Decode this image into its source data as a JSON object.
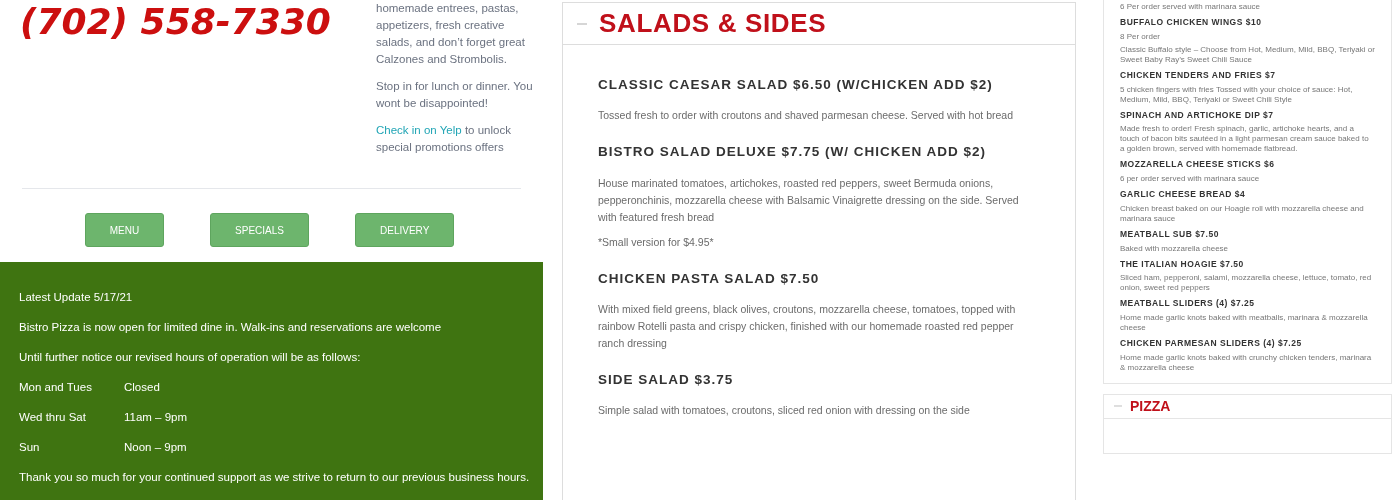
{
  "phone": "(702) 558-7330",
  "intro": {
    "paragraphs": [
      {
        "text": "homemade entrees, pastas, appetizers, fresh creative salads, and don’t forget great Calzones and Strombolis."
      },
      {
        "text": "Stop in for lunch or dinner. You wont be disappointed!"
      },
      {
        "link": "Check in on Yelp",
        "text": " to unlock special promotions offers"
      }
    ]
  },
  "nav_buttons": [
    "MENU",
    "SPECIALS",
    "DELIVERY"
  ],
  "notice": {
    "lines": [
      "Latest Update 5/17/21",
      "Bistro Pizza is now open for limited dine in. Walk-ins and reservations are welcome",
      "Until further notice our revised hours of operation will be as follows:"
    ],
    "hours": [
      {
        "day": "Mon and Tues",
        "time": "Closed"
      },
      {
        "day": "Wed thru Sat",
        "time": "11am – 9pm"
      },
      {
        "day": "Sun",
        "time": "Noon – 9pm"
      }
    ],
    "closing": "Thank you so much for your continued support as we strive to return to our previous business hours."
  },
  "salads_section": {
    "title": "SALADS & SIDES",
    "expanded": true,
    "items": [
      {
        "name": "CLASSIC CAESAR SALAD $6.50 (W/CHICKEN ADD $2)",
        "descriptions": [
          "Tossed fresh to order with croutons and shaved parmesan cheese. Served with hot bread"
        ]
      },
      {
        "name": "BISTRO SALAD DELUXE $7.75 (W/ CHICKEN ADD $2)",
        "descriptions": [
          "House marinated tomatoes, artichokes, roasted red peppers, sweet Bermuda onions, pepperonchinis, mozzarella cheese with Balsamic Vinaigrette dressing on the side. Served with featured fresh bread",
          "*Small version for $4.95*"
        ]
      },
      {
        "name": "CHICKEN PASTA SALAD $7.50",
        "descriptions": [
          "With mixed field greens, black olives, croutons, mozzarella cheese, tomatoes, topped with rainbow Rotelli pasta and crispy chicken, finished with our homemade roasted red pepper ranch dressing"
        ]
      },
      {
        "name": "SIDE SALAD $3.75",
        "descriptions": [
          "Simple salad with tomatoes, croutons, sliced red onion with dressing on the side"
        ]
      }
    ]
  },
  "appetizers": {
    "top_note": "6 Per order served with marinara sauce",
    "items": [
      {
        "name": "BUFFALO CHICKEN WINGS $10",
        "descriptions": [
          "8 Per order",
          "Classic Buffalo style – Choose from Hot, Medium, Mild, BBQ, Teriyaki or Sweet Baby Ray’s Sweet Chili Sauce"
        ]
      },
      {
        "name": "CHICKEN TENDERS AND FRIES $7",
        "descriptions": [
          "5 chicken fingers with fries Tossed with your choice of sauce: Hot, Medium, Mild, BBQ, Teriyaki or Sweet Chili Style"
        ]
      },
      {
        "name": "SPINACH AND ARTICHOKE DIP $7",
        "descriptions": [
          "Made fresh to order! Fresh spinach, garlic, artichoke hearts, and a touch of bacon bits sautéed in a light parmesan cream sauce baked to a golden brown, served with homemade flatbread."
        ]
      },
      {
        "name": "MOZZARELLA CHEESE STICKS $6",
        "descriptions": [
          "6 per order served with marinara sauce"
        ]
      },
      {
        "name": "GARLIC CHEESE BREAD $4",
        "descriptions": [
          "Chicken breast baked on our Hoagie roll with mozzarella cheese and marinara sauce"
        ]
      },
      {
        "name": "MEATBALL SUB $7.50",
        "descriptions": [
          "Baked with mozzarella cheese"
        ]
      },
      {
        "name": "THE ITALIAN HOAGIE $7.50",
        "descriptions": [
          "Sliced ham, pepperoni, salami, mozzarella cheese, lettuce, tomato, red onion, sweet red peppers"
        ]
      },
      {
        "name": "MEATBALL SLIDERS (4) $7.25",
        "descriptions": [
          "Home made garlic knots baked with meatballs, marinara & mozzarella cheese"
        ]
      },
      {
        "name": "CHICKEN PARMESAN SLIDERS (4) $7.25",
        "descriptions": [
          "Home made garlic knots baked with crunchy chicken tenders, marinara & mozzarella cheese"
        ]
      }
    ]
  },
  "pizza_section": {
    "title": "PIZZA",
    "expanded": true
  }
}
